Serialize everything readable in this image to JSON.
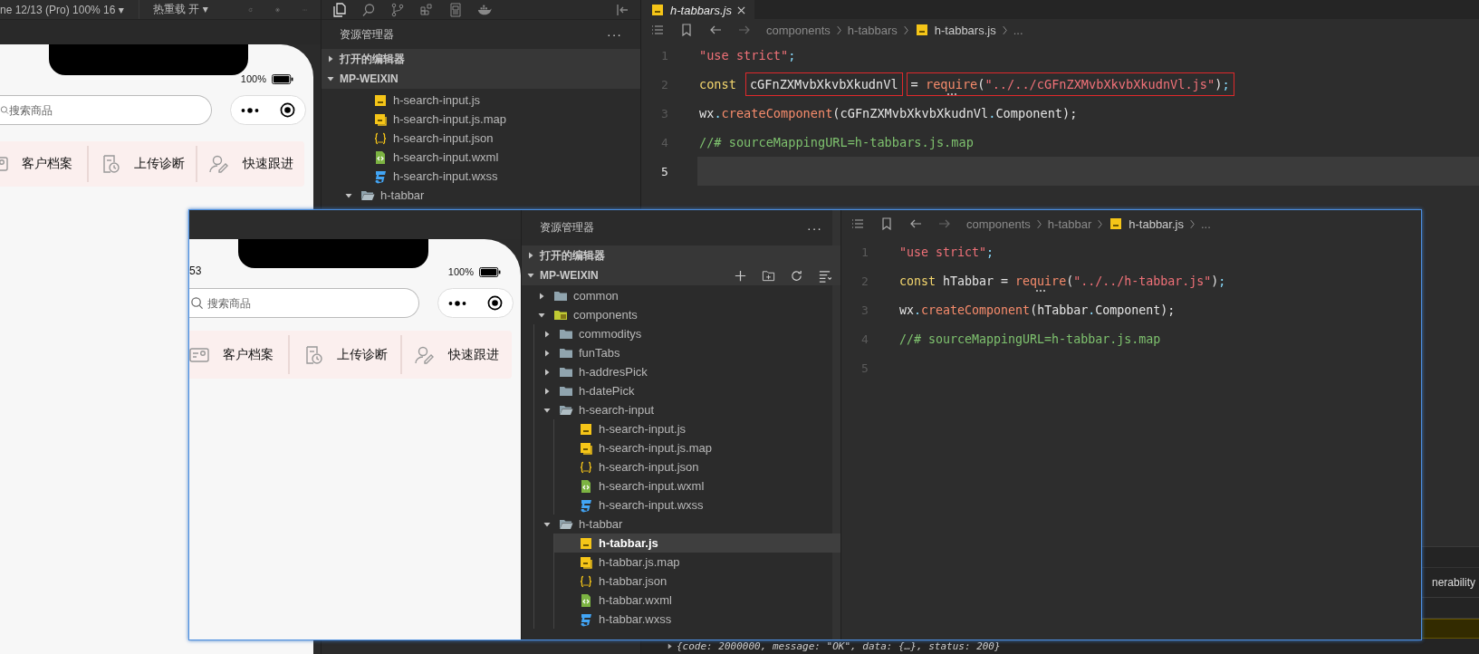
{
  "back_window": {
    "toolbar": {
      "device": "ne 12/13 (Pro) 100% 16 ▾",
      "hot_reload": "热重载 开 ▾"
    },
    "simulator": {
      "battery": "100%",
      "search": {
        "placeholder": "搜索商品"
      },
      "shortcuts": [
        {
          "label": "客户档案"
        },
        {
          "label": "上传诊断"
        },
        {
          "label": "快速跟进"
        }
      ]
    },
    "explorer": {
      "title": "资源管理器",
      "more": "···",
      "sections": [
        {
          "label": "打开的编辑器",
          "expanded": false
        },
        {
          "label": "MP-WEIXIN",
          "expanded": true
        }
      ],
      "items": [
        {
          "kind": "js",
          "label": "h-search-input.js"
        },
        {
          "kind": "jsmap",
          "label": "h-search-input.js.map"
        },
        {
          "kind": "json",
          "label": "h-search-input.json"
        },
        {
          "kind": "wxml",
          "label": "h-search-input.wxml"
        },
        {
          "kind": "wxss",
          "label": "h-search-input.wxss"
        },
        {
          "kind": "folder",
          "label": "h-tabbar",
          "expanded": true
        }
      ]
    },
    "editor": {
      "tab": {
        "label": "h-tabbars.js",
        "selected": true
      },
      "breadcrumbs": [
        {
          "kind": "text",
          "label": "components"
        },
        {
          "kind": "text",
          "label": "h-tabbars"
        },
        {
          "kind": "js",
          "label": "h-tabbars.js"
        },
        {
          "kind": "text",
          "label": "..."
        }
      ],
      "lines": [
        {
          "number": "1",
          "current": false,
          "segments": [
            {
              "highlighted": false,
              "tokens": [
                {
                  "kind": "string",
                  "text": "\"use strict\""
                },
                {
                  "kind": "punct",
                  "text": ";"
                }
              ]
            }
          ]
        },
        {
          "number": "2",
          "current": false,
          "segments": [
            {
              "highlighted": false,
              "tokens": [
                {
                  "kind": "keyword",
                  "text": "const"
                }
              ]
            },
            {
              "highlighted": true,
              "tokens": [
                {
                  "kind": "plain",
                  "text": "cGFnZXMvbXkvbXkudnVl"
                }
              ]
            },
            {
              "highlighted": true,
              "tokens": [
                {
                  "kind": "plain",
                  "text": "= "
                },
                {
                  "kind": "func",
                  "text": "require",
                  "hint": true
                },
                {
                  "kind": "plain",
                  "text": "("
                },
                {
                  "kind": "string",
                  "text": "\"../../cGFnZXMvbXkvbXkudnVl.js\""
                },
                {
                  "kind": "plain",
                  "text": ")"
                },
                {
                  "kind": "punct",
                  "text": ";"
                }
              ]
            }
          ]
        },
        {
          "number": "3",
          "current": false,
          "segments": [
            {
              "highlighted": false,
              "tokens": [
                {
                  "kind": "plain",
                  "text": "wx"
                },
                {
                  "kind": "punct",
                  "text": "."
                },
                {
                  "kind": "func",
                  "text": "createComponent"
                },
                {
                  "kind": "plain",
                  "text": "(cGFnZXMvbXkvbXkudnVl"
                },
                {
                  "kind": "punct",
                  "text": "."
                },
                {
                  "kind": "plain",
                  "text": "Component);"
                }
              ]
            }
          ]
        },
        {
          "number": "4",
          "current": false,
          "segments": [
            {
              "highlighted": false,
              "tokens": [
                {
                  "kind": "comment",
                  "text": "//# sourceMappingURL=h-tabbars.js.map"
                }
              ]
            }
          ]
        },
        {
          "number": "5",
          "current": true
        }
      ]
    },
    "devtools": {
      "tab": "nerability",
      "console_line": "{code: 2000000, message: \"OK\", data: {…}, status: 200}"
    }
  },
  "front_window": {
    "simulator": {
      "time": "53",
      "battery": "100%",
      "search": {
        "placeholder": "搜索商品"
      },
      "shortcuts": [
        {
          "label": "客户档案"
        },
        {
          "label": "上传诊断"
        },
        {
          "label": "快速跟进"
        }
      ]
    },
    "explorer": {
      "title": "资源管理器",
      "more": "···",
      "sections": [
        {
          "label": "打开的编辑器",
          "expanded": false
        },
        {
          "label": "MP-WEIXIN",
          "expanded": true
        }
      ],
      "tree": [
        {
          "kind": "folder",
          "label": "common",
          "expanded": false,
          "selected": false
        },
        {
          "kind": "folder",
          "label": "components",
          "expanded": true,
          "special": true,
          "selected": false,
          "children": [
            {
              "kind": "folder",
              "label": "commoditys",
              "expanded": false,
              "selected": false
            },
            {
              "kind": "folder",
              "label": "funTabs",
              "expanded": false,
              "selected": false
            },
            {
              "kind": "folder",
              "label": "h-addresPick",
              "expanded": false,
              "selected": false
            },
            {
              "kind": "folder",
              "label": "h-datePick",
              "expanded": false,
              "selected": false
            },
            {
              "kind": "folder",
              "label": "h-search-input",
              "expanded": true,
              "selected": false,
              "children": [
                {
                  "kind": "js",
                  "label": "h-search-input.js",
                  "selected": false
                },
                {
                  "kind": "jsmap",
                  "label": "h-search-input.js.map",
                  "selected": false
                },
                {
                  "kind": "json",
                  "label": "h-search-input.json",
                  "selected": false
                },
                {
                  "kind": "wxml",
                  "label": "h-search-input.wxml",
                  "selected": false
                },
                {
                  "kind": "wxss",
                  "label": "h-search-input.wxss",
                  "selected": false
                }
              ]
            },
            {
              "kind": "folder",
              "label": "h-tabbar",
              "expanded": true,
              "selected": false,
              "children": [
                {
                  "kind": "js",
                  "label": "h-tabbar.js",
                  "selected": true
                },
                {
                  "kind": "jsmap",
                  "label": "h-tabbar.js.map",
                  "selected": false
                },
                {
                  "kind": "json",
                  "label": "h-tabbar.json",
                  "selected": false
                },
                {
                  "kind": "wxml",
                  "label": "h-tabbar.wxml",
                  "selected": false
                },
                {
                  "kind": "wxss",
                  "label": "h-tabbar.wxss",
                  "selected": false
                }
              ]
            }
          ]
        }
      ]
    },
    "editor": {
      "breadcrumbs": [
        {
          "kind": "text",
          "label": "components"
        },
        {
          "kind": "text",
          "label": "h-tabbar"
        },
        {
          "kind": "js",
          "label": "h-tabbar.js"
        },
        {
          "kind": "text",
          "label": "..."
        }
      ],
      "lines": [
        {
          "number": "1",
          "current": false,
          "segments": [
            {
              "highlighted": false,
              "tokens": [
                {
                  "kind": "string",
                  "text": "\"use strict\""
                },
                {
                  "kind": "punct",
                  "text": ";"
                }
              ]
            }
          ]
        },
        {
          "number": "2",
          "current": false,
          "segments": [
            {
              "highlighted": false,
              "tokens": [
                {
                  "kind": "keyword",
                  "text": "const"
                },
                {
                  "kind": "plain",
                  "text": " hTabbar = "
                },
                {
                  "kind": "func",
                  "text": "require",
                  "hint": true
                },
                {
                  "kind": "plain",
                  "text": "("
                },
                {
                  "kind": "string",
                  "text": "\"../../h-tabbar.js\""
                },
                {
                  "kind": "plain",
                  "text": ")"
                },
                {
                  "kind": "punct",
                  "text": ";"
                }
              ]
            }
          ]
        },
        {
          "number": "3",
          "current": false,
          "segments": [
            {
              "highlighted": false,
              "tokens": [
                {
                  "kind": "plain",
                  "text": "wx"
                },
                {
                  "kind": "punct",
                  "text": "."
                },
                {
                  "kind": "func",
                  "text": "createComponent"
                },
                {
                  "kind": "plain",
                  "text": "(hTabbar"
                },
                {
                  "kind": "punct",
                  "text": "."
                },
                {
                  "kind": "plain",
                  "text": "Component);"
                }
              ]
            }
          ]
        },
        {
          "number": "4",
          "current": false,
          "segments": [
            {
              "highlighted": false,
              "tokens": [
                {
                  "kind": "comment",
                  "text": "//# sourceMappingURL=h-tabbar.js.map"
                }
              ]
            }
          ]
        },
        {
          "number": "5",
          "current": false
        }
      ]
    }
  }
}
